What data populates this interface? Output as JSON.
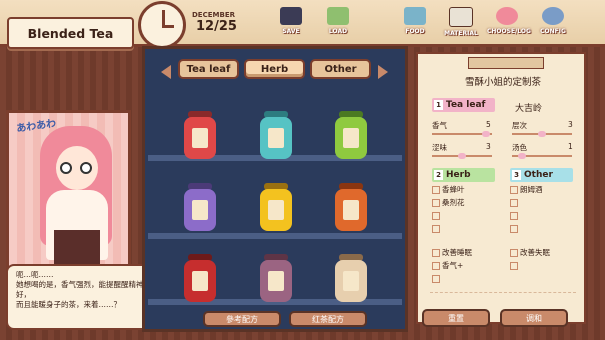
{
  "title": "Blended Tea",
  "date": {
    "month": "DECEMBER",
    "day": "12/25"
  },
  "top_menu": [
    {
      "label": "SAVE",
      "icon": "cassette-icon",
      "color": "#3b3b55"
    },
    {
      "label": "LOAD",
      "icon": "play-icon",
      "color": "#8fbf6f"
    },
    {
      "label": "FOOD",
      "icon": "jar-icon",
      "color": "#7ab3c9"
    },
    {
      "label": "MATERIAL",
      "icon": "book-icon",
      "color": "#e9e2d5"
    },
    {
      "label": "CHOOSE/LOG",
      "icon": "portrait-icon",
      "color": "#f08a9a"
    },
    {
      "label": "CONFIG",
      "icon": "gear-icon",
      "color": "#7a9cc7"
    }
  ],
  "tabs": [
    "Tea leaf",
    "Herb",
    "Other"
  ],
  "emote_text": "あわあわ",
  "dialog": {
    "lines": [
      "呃…呃……",
      "她想喝的是，香气强烈，能提醒醒精神，对美容好，",
      "而且能暖身子的茶，来着……？"
    ]
  },
  "shelf_buttons": [
    "參考配方",
    "红茶配方"
  ],
  "recipe": {
    "title": "雪酥小姐的定制茶",
    "sections": {
      "tea_leaf": {
        "num": "1",
        "label": "Tea leaf",
        "value": "大吉岭"
      },
      "herb": {
        "num": "2",
        "label": "Herb"
      },
      "other": {
        "num": "3",
        "label": "Other"
      }
    },
    "stats": [
      {
        "name": "香气",
        "value": "5"
      },
      {
        "name": "层次",
        "value": "3"
      },
      {
        "name": "涩味",
        "value": "3"
      },
      {
        "name": "汤色",
        "value": "1"
      }
    ],
    "herbs": [
      "香蜂叶",
      "桑剂花"
    ],
    "others": [
      "朗姆酒"
    ],
    "effects": [
      "改善睡眠",
      "改善失眠",
      "香气+"
    ],
    "buttons": [
      "重置",
      "调和"
    ]
  },
  "colors": {
    "accent": "#7b3e2d",
    "tea_leaf_tag": "#f2b3c8",
    "herb_tag": "#b9e3a0",
    "other_tag": "#a8e0e8"
  }
}
